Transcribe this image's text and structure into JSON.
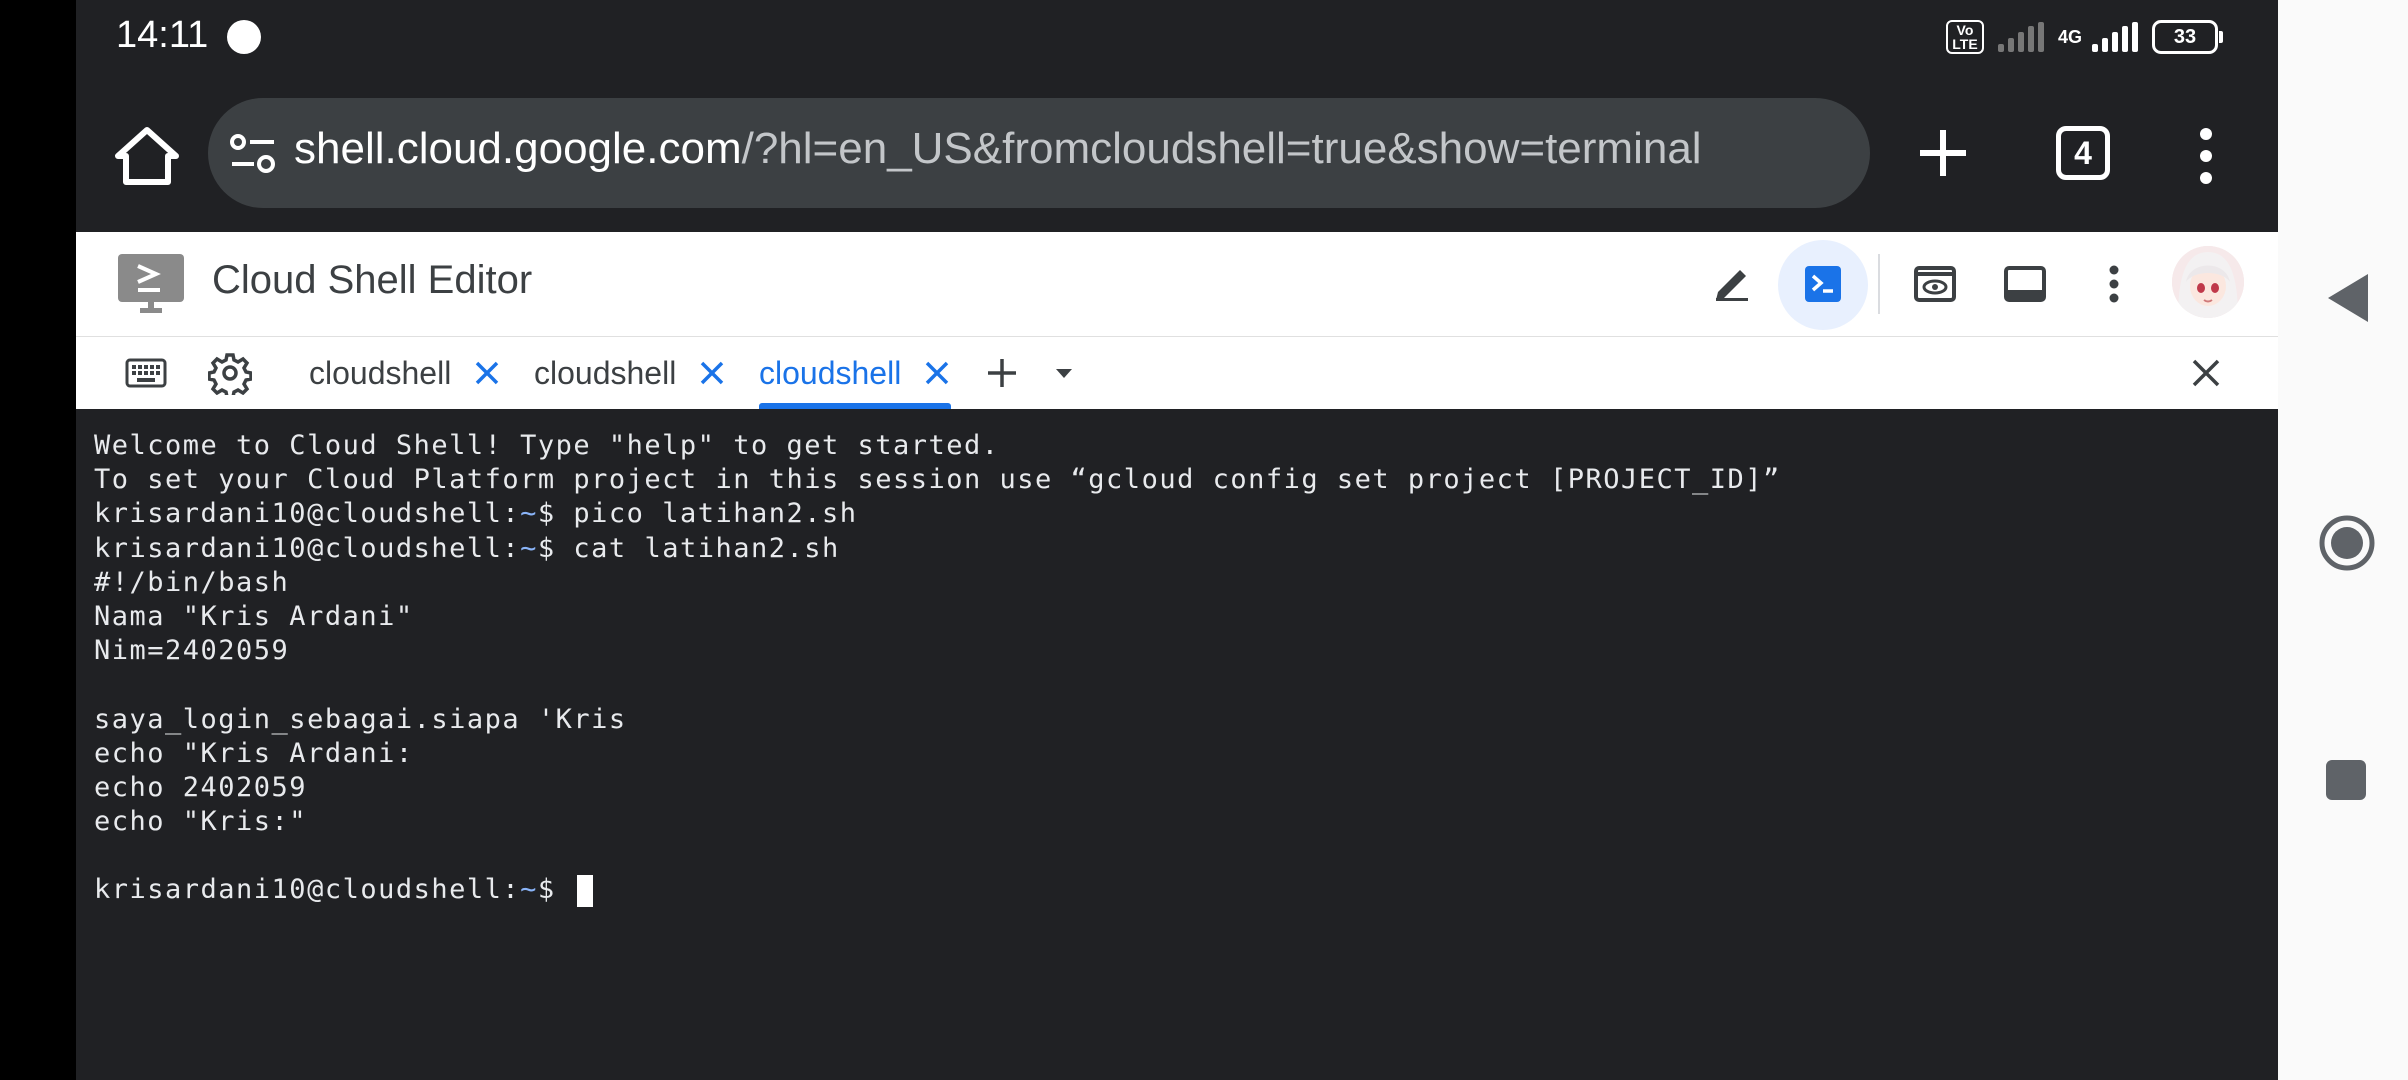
{
  "status_bar": {
    "time": "14:11",
    "volte": "Vo LTE",
    "network": "4G",
    "battery": "33"
  },
  "browser": {
    "url_host": "shell.cloud.google.com",
    "url_rest": "/?hl=en_US&fromcloudshell=true&show=terminal",
    "tab_count": "4"
  },
  "editor": {
    "title": "Cloud Shell Editor"
  },
  "tabs": [
    {
      "label": "cloudshell",
      "active": false
    },
    {
      "label": "cloudshell",
      "active": false
    },
    {
      "label": "cloudshell",
      "active": true
    }
  ],
  "terminal": {
    "lines": [
      {
        "text": "Welcome to Cloud Shell! Type \"help\" to get started."
      },
      {
        "text": "To set your Cloud Platform project in this session use “gcloud config set project [PROJECT_ID]”"
      },
      {
        "prompt": "krisardani10@cloudshell:",
        "tilde": "~",
        "suffix": "$ pico latihan2.sh"
      },
      {
        "prompt": "krisardani10@cloudshell:",
        "tilde": "~",
        "suffix": "$ cat latihan2.sh"
      },
      {
        "text": "#!/bin/bash"
      },
      {
        "text": "Nama \"Kris Ardani\""
      },
      {
        "text": "Nim=2402059"
      },
      {
        "text": ""
      },
      {
        "text": "saya_login_sebagai.siapa 'Kris"
      },
      {
        "text": "echo \"Kris Ardani:"
      },
      {
        "text": "echo 2402059"
      },
      {
        "text": "echo \"Kris:\""
      },
      {
        "text": ""
      },
      {
        "prompt": "krisardani10@cloudshell:",
        "tilde": "~",
        "suffix": "$ ",
        "cursor": true
      }
    ]
  },
  "colors": {
    "accent": "#1a73e8",
    "terminal_bg": "#202124",
    "prompt_tilde": "#8ab4f8"
  }
}
